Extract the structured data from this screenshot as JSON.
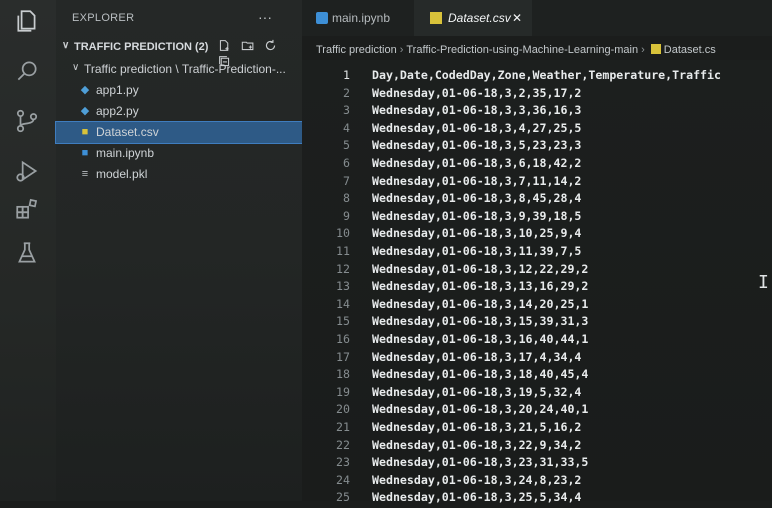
{
  "explorer": {
    "title": "EXPLORER",
    "more": "···",
    "section_label": "TRAFFIC PREDICTION (2)",
    "folder_label": "Traffic prediction \\ Traffic-Prediction-...",
    "files": [
      {
        "name": "app1.py",
        "icon": "python-file-icon",
        "selected": false
      },
      {
        "name": "app2.py",
        "icon": "python-file-icon",
        "selected": false
      },
      {
        "name": "Dataset.csv",
        "icon": "csv-file-icon",
        "selected": true
      },
      {
        "name": "main.ipynb",
        "icon": "notebook-file-icon",
        "selected": false
      },
      {
        "name": "model.pkl",
        "icon": "binary-file-icon",
        "selected": false
      }
    ]
  },
  "tabs": [
    {
      "label": "main.ipynb",
      "active": false
    },
    {
      "label": "Dataset.csv",
      "active": true,
      "close": "✕"
    }
  ],
  "breadcrumb": {
    "parts": [
      "Traffic prediction",
      "Traffic-Prediction-using-Machine-Learning-main",
      "Dataset.cs"
    ]
  },
  "editor": {
    "lines": [
      "Day,Date,CodedDay,Zone,Weather,Temperature,Traffic",
      "Wednesday,01-06-18,3,2,35,17,2",
      "Wednesday,01-06-18,3,3,36,16,3",
      "Wednesday,01-06-18,3,4,27,25,5",
      "Wednesday,01-06-18,3,5,23,23,3",
      "Wednesday,01-06-18,3,6,18,42,2",
      "Wednesday,01-06-18,3,7,11,14,2",
      "Wednesday,01-06-18,3,8,45,28,4",
      "Wednesday,01-06-18,3,9,39,18,5",
      "Wednesday,01-06-18,3,10,25,9,4",
      "Wednesday,01-06-18,3,11,39,7,5",
      "Wednesday,01-06-18,3,12,22,29,2",
      "Wednesday,01-06-18,3,13,16,29,2",
      "Wednesday,01-06-18,3,14,20,25,1",
      "Wednesday,01-06-18,3,15,39,31,3",
      "Wednesday,01-06-18,3,16,40,44,1",
      "Wednesday,01-06-18,3,17,4,34,4",
      "Wednesday,01-06-18,3,18,40,45,4",
      "Wednesday,01-06-18,3,19,5,32,4",
      "Wednesday,01-06-18,3,20,24,40,1",
      "Wednesday,01-06-18,3,21,5,16,2",
      "Wednesday,01-06-18,3,22,9,34,2",
      "Wednesday,01-06-18,3,23,31,33,5",
      "Wednesday,01-06-18,3,24,8,23,2",
      "Wednesday,01-06-18,3,25,5,34,4"
    ],
    "active_line": 1
  },
  "colors": {
    "selection": "#2e5a86",
    "csv_icon": "#d8c23a",
    "python_icon": "#4f9fd8"
  }
}
